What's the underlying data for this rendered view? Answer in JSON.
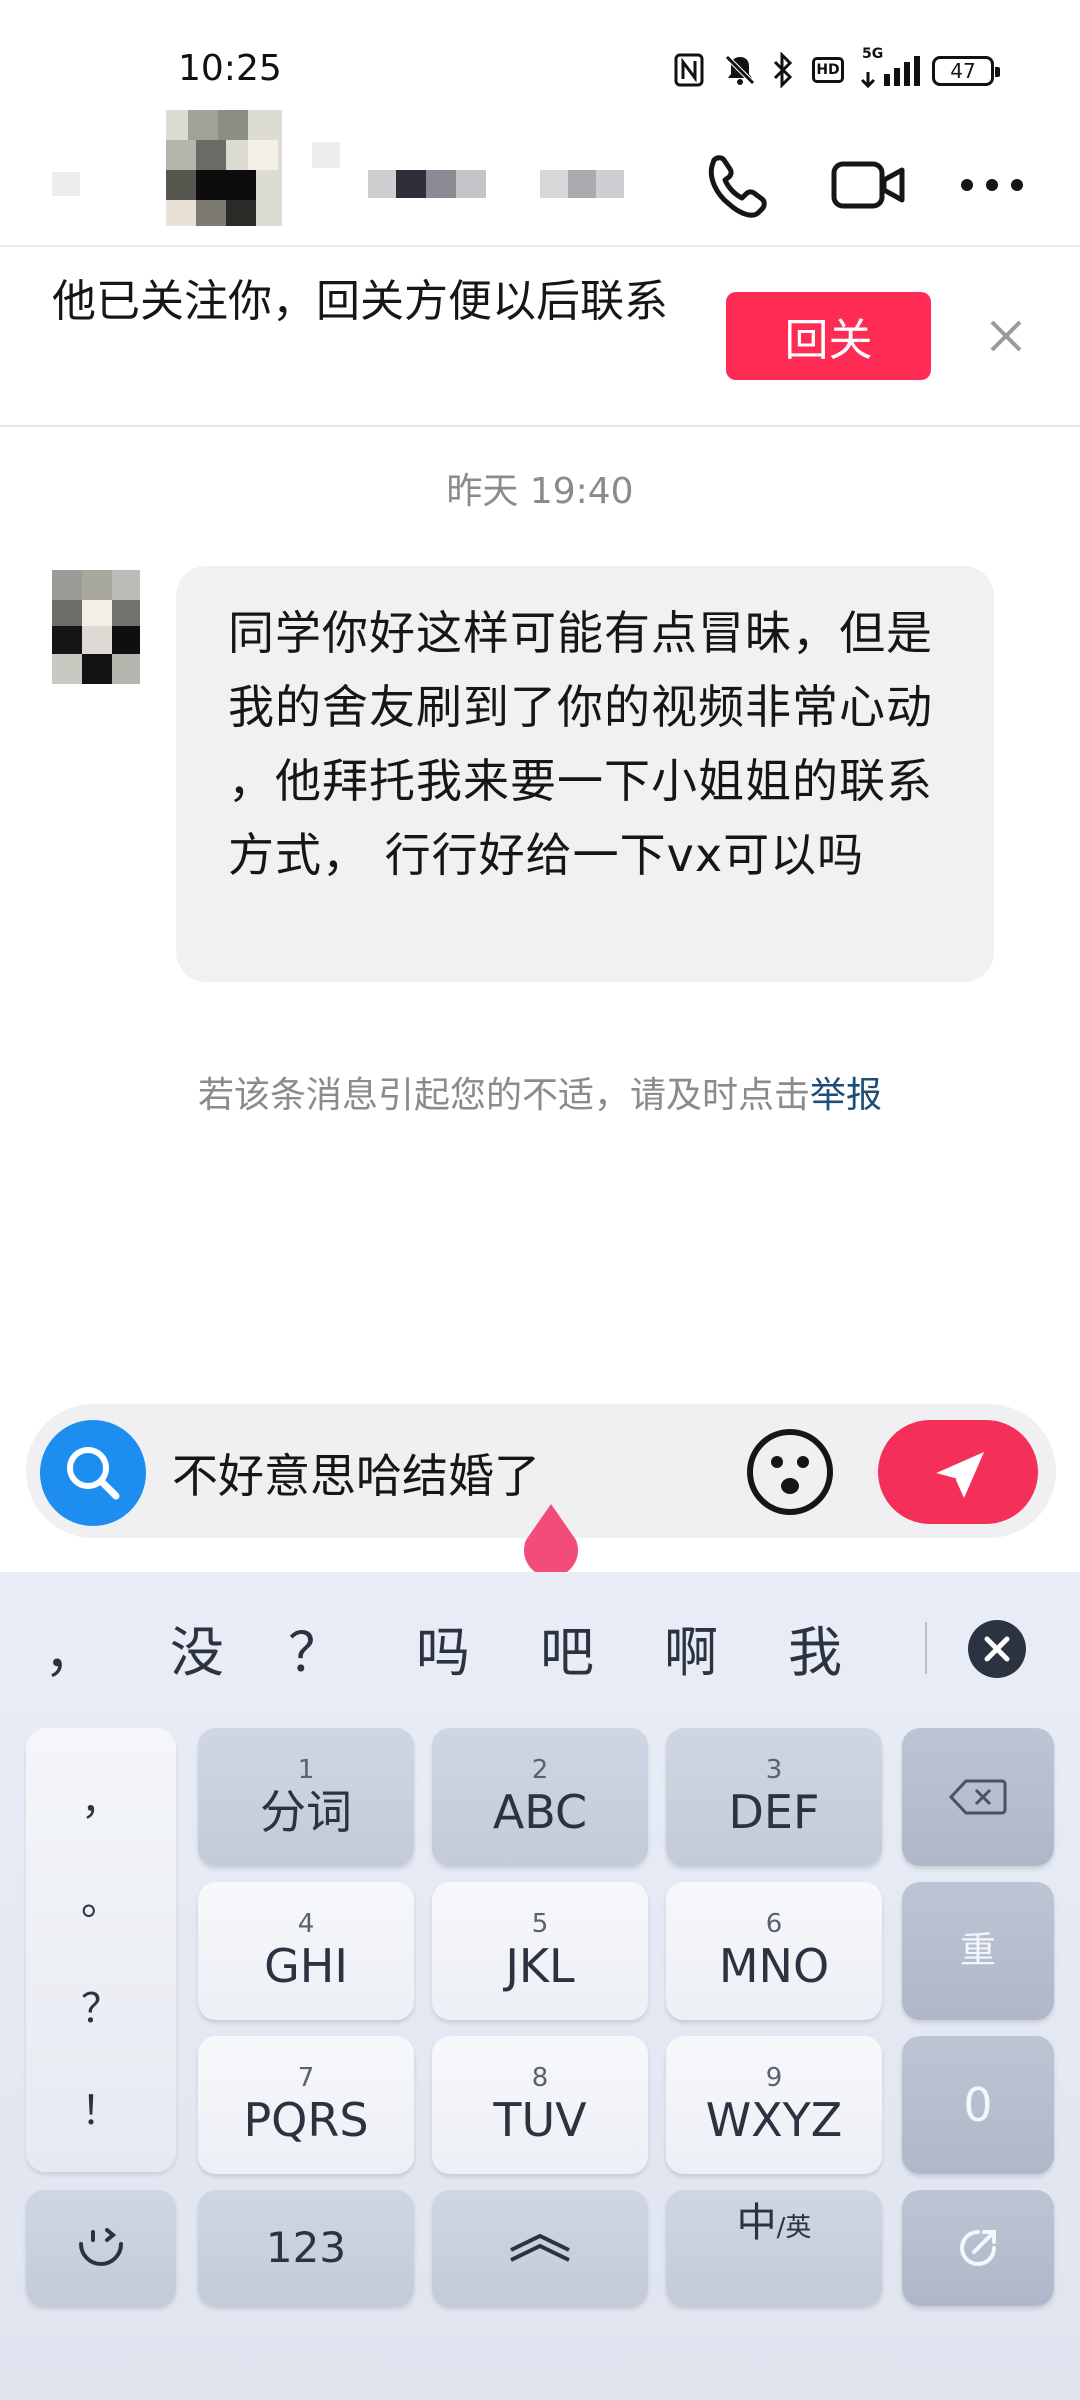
{
  "status_bar": {
    "time": "10:25",
    "icons": [
      "nfc-icon",
      "mute-icon",
      "bluetooth-icon",
      "hd-icon",
      "5g-signal-icon"
    ],
    "hd_label": "HD",
    "network_label": "5G",
    "battery": "47"
  },
  "header": {
    "icons": [
      "phone-icon",
      "video-icon",
      "more-icon"
    ]
  },
  "follow_banner": {
    "text": "他已关注你，回关方便以后联系",
    "button": "回关"
  },
  "chat": {
    "timestamp": "昨天 19:40",
    "message": "同学你好这样可能有点冒昧，但是我的舍友刷到了你的视频非常心动 ，他拜托我来要一下小姐姐的联系方式， 行行好给一下vx可以吗",
    "report_prefix": "若该条消息引起您的不适，请及时点击",
    "report_link": "举报"
  },
  "input": {
    "value": "不好意思哈结婚了"
  },
  "keyboard": {
    "candidates": [
      "，",
      "没",
      "？",
      "吗",
      "吧",
      "啊",
      "我"
    ],
    "punctuation": [
      "，",
      "。",
      "？",
      "！"
    ],
    "keys": [
      {
        "num": "1",
        "label": "分词"
      },
      {
        "num": "2",
        "label": "ABC"
      },
      {
        "num": "3",
        "label": "DEF"
      },
      {
        "num": "4",
        "label": "GHI"
      },
      {
        "num": "5",
        "label": "JKL"
      },
      {
        "num": "6",
        "label": "MNO"
      },
      {
        "num": "7",
        "label": "PQRS"
      },
      {
        "num": "8",
        "label": "TUV"
      },
      {
        "num": "9",
        "label": "WXYZ"
      }
    ],
    "reset_label": "重",
    "zero_label": "0",
    "num_mode_label": "123",
    "lang_main": "中",
    "lang_sub": "/英"
  }
}
